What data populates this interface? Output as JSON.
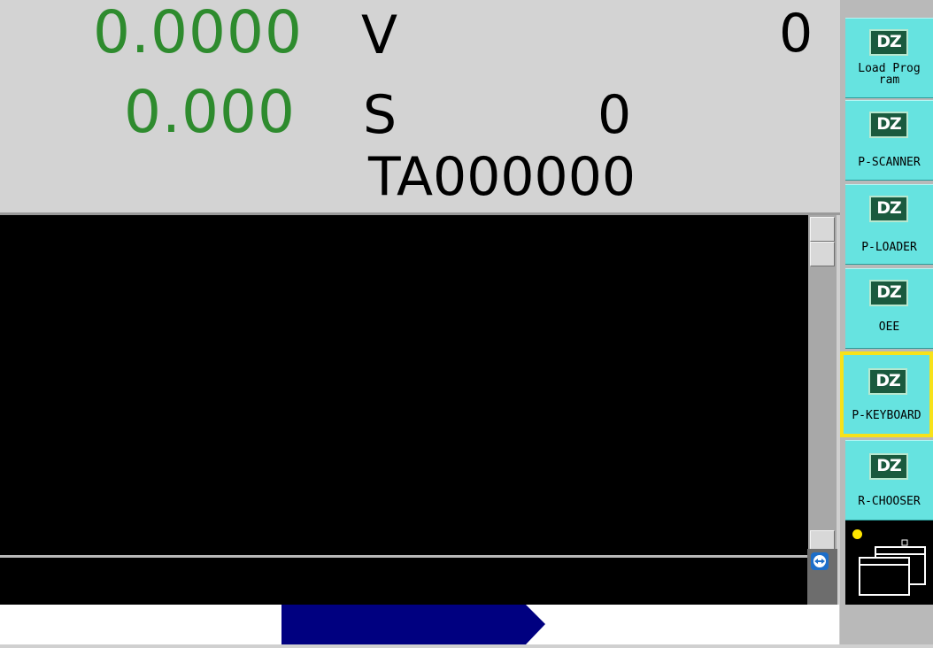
{
  "readouts": {
    "value_1": "0.0000",
    "unit_1": "V",
    "count_1": "0",
    "value_2": "0.000",
    "unit_2": "S",
    "count_2": "0",
    "tool_code": "TA000000"
  },
  "side_buttons": [
    {
      "logo": "DZ",
      "label": "Load Prog\nram"
    },
    {
      "logo": "DZ",
      "label": "P-SCANNER"
    },
    {
      "logo": "DZ",
      "label": "P-LOADER"
    },
    {
      "logo": "DZ",
      "label": "OEE"
    },
    {
      "logo": "DZ",
      "label": "P-KEYBOARD"
    },
    {
      "logo": "DZ",
      "label": "R-CHOOSER"
    }
  ],
  "colors": {
    "readout_green": "#2e8b2e",
    "button_cyan": "#66e3e0",
    "selected_outline": "#f7e21a",
    "progress_blue": "#000080",
    "status_dot": "#ffe600"
  },
  "icons": {
    "dz_logo": "dz-logo-icon",
    "windows": "window-switch-icon",
    "teamviewer": "teamviewer-icon"
  },
  "progress": {
    "fraction_start": 0.335,
    "fraction_end": 0.652
  }
}
